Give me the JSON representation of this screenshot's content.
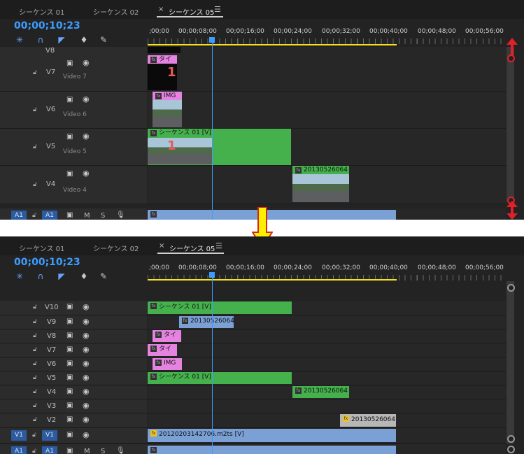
{
  "panel_top": {
    "tabs": [
      {
        "label": "シーケンス 01",
        "active": false
      },
      {
        "label": "シーケンス 02",
        "active": false
      },
      {
        "label": "シーケンス 05",
        "active": true
      }
    ],
    "close_glyph": "×",
    "menu_glyph": "☰",
    "timecode": "00;00;10;23",
    "ruler_labels": [
      ";00;00",
      "00;00;08;00",
      "00;00;16;00",
      "00;00;24;00",
      "00;00;32;00",
      "00;00;40;00",
      "00;00;48;00",
      "00;00;56;00"
    ],
    "tracks": [
      {
        "name": "V8",
        "sub": ""
      },
      {
        "name": "V7",
        "sub": "Video 7"
      },
      {
        "name": "V6",
        "sub": "Video 6"
      },
      {
        "name": "V5",
        "sub": "Video 5"
      },
      {
        "name": "V4",
        "sub": "Video 4"
      }
    ],
    "audio_row": {
      "a1_left": "A1",
      "a1_right": "A1",
      "m": "M",
      "s": "S"
    },
    "clips": {
      "v7": "タイ",
      "v6": "IMG",
      "v5": "シーケンス 01 [V]",
      "v4": "20130526064",
      "number_overlay": "1"
    }
  },
  "panel_bottom": {
    "tabs": [
      {
        "label": "シーケンス 01",
        "active": false
      },
      {
        "label": "シーケンス 02",
        "active": false
      },
      {
        "label": "シーケンス 05",
        "active": true
      }
    ],
    "close_glyph": "×",
    "menu_glyph": "☰",
    "timecode": "00;00;10;23",
    "ruler_labels": [
      ";00;00",
      "00;00;08;00",
      "00;00;16;00",
      "00;00;24;00",
      "00;00;32;00",
      "00;00;40;00",
      "00;00;48;00",
      "00;00;56;00"
    ],
    "tracks": [
      {
        "name": "V10"
      },
      {
        "name": "V9"
      },
      {
        "name": "V8"
      },
      {
        "name": "V7"
      },
      {
        "name": "V6"
      },
      {
        "name": "V5"
      },
      {
        "name": "V4"
      },
      {
        "name": "V3"
      },
      {
        "name": "V2"
      },
      {
        "name": "V1"
      }
    ],
    "v1_left": "V1",
    "v1_right": "V1",
    "audio_row": {
      "a1_left": "A1",
      "a1_right": "A1",
      "m": "M",
      "s": "S"
    },
    "clips": {
      "v10": "シーケンス 01 [V]",
      "v9": "20130526064",
      "v8": "タイ",
      "v7": "タイ",
      "v6": "IMG",
      "v5": "シーケンス 01 [V]",
      "v4": "20130526064",
      "v2": "20130526064",
      "v1": "20120203142706.m2ts [V]"
    }
  },
  "icons": [
    "snap-icon",
    "magnet-icon",
    "marker-icon",
    "marker-flag-icon",
    "wrench-icon",
    "lock-icon",
    "film-icon",
    "eye-icon",
    "mic-icon",
    "fx-badge-icon",
    "scroll-handle-icon",
    "down-arrow-icon",
    "resize-arrow-icon"
  ],
  "colors": {
    "accent": "#3d9dff",
    "clip_green": "#45b14d",
    "clip_pink": "#e583e0",
    "clip_blue": "#7aa0d6",
    "workarea": "#f5e11f",
    "arrow_red": "#e0202a",
    "arrow_yellow": "#ffee00"
  },
  "fx_badge": "fx"
}
